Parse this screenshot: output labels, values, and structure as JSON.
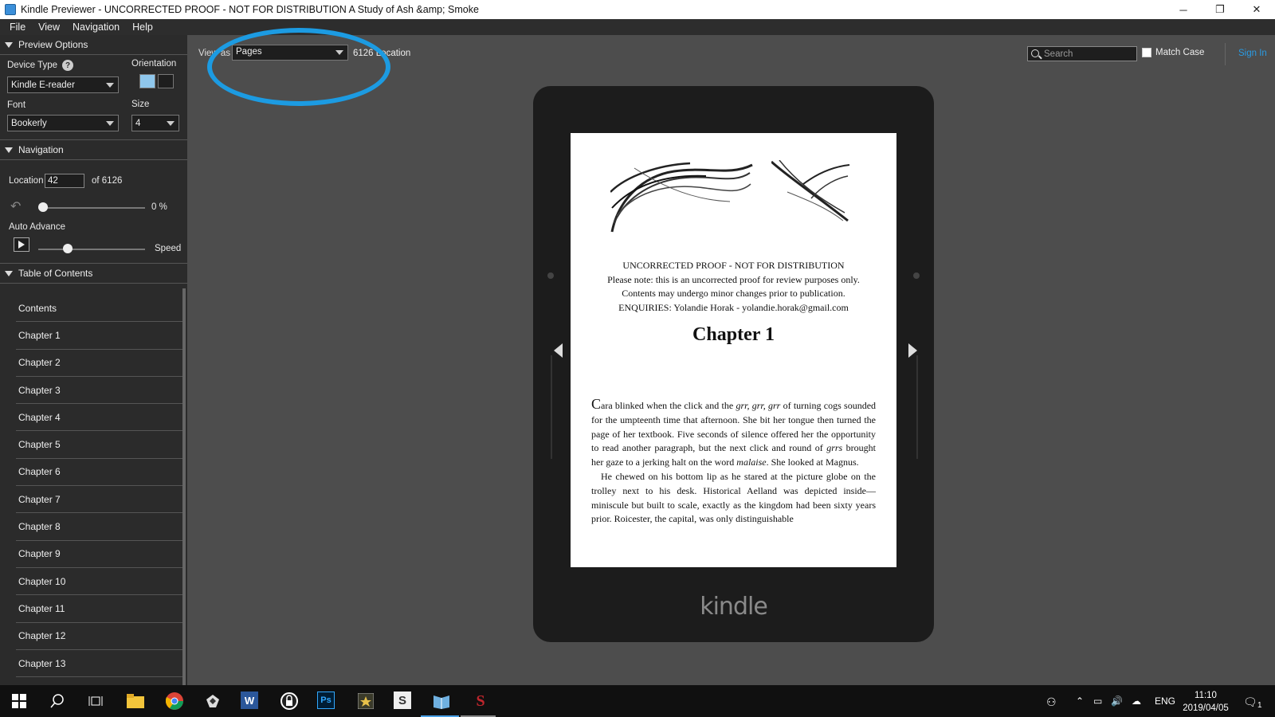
{
  "window": {
    "title": "Kindle Previewer - UNCORRECTED PROOF - NOT FOR DISTRIBUTION A Study of Ash &amp; Smoke",
    "minimize": "─",
    "restore": "❐",
    "close": "✕"
  },
  "menu": [
    "File",
    "View",
    "Navigation",
    "Help"
  ],
  "sidebar": {
    "preview_options": "Preview Options",
    "device_type_label": "Device Type",
    "device_type_value": "Kindle E-reader",
    "orientation_label": "Orientation",
    "font_label": "Font",
    "font_value": "Bookerly",
    "size_label": "Size",
    "size_value": "4",
    "navigation": "Navigation",
    "location_label": "Location",
    "location_value": "42",
    "location_of": "of 6126",
    "progress_percent": "0 %",
    "progress_fraction": 0,
    "auto_advance": "Auto Advance",
    "speed_label": "Speed",
    "speed_fraction": 0.25,
    "toc_header": "Table of Contents",
    "toc": [
      "Contents",
      "Chapter 1",
      "Chapter 2",
      "Chapter 3",
      "Chapter 4",
      "Chapter 5",
      "Chapter 6",
      "Chapter 7",
      "Chapter 8",
      "Chapter 9",
      "Chapter 10",
      "Chapter 11",
      "Chapter 12",
      "Chapter 13"
    ]
  },
  "toolbar": {
    "view_label": "View as",
    "view_value": "Pages",
    "location_count": "6126 Location",
    "search_placeholder": "Search",
    "match_case": "Match Case",
    "sign_in": "Sign In"
  },
  "page": {
    "proof_lines": [
      "UNCORRECTED PROOF - NOT FOR DISTRIBUTION",
      "Please note: this is an uncorrected proof for review purposes only.",
      "Contents may undergo minor changes prior to publication.",
      "ENQUIRIES: Yolandie Horak - yolandie.horak@gmail.com"
    ],
    "chapter_title": "Chapter 1",
    "dropcap": "C",
    "para1_a": "ara blinked when the click and the ",
    "para1_italic": "grr, grr, grr",
    "para1_b": " of turning cogs sounded for the umpteenth time that afternoon. She bit her tongue then turned the page of her textbook. Five seconds of silence offered her the opportunity to read another paragraph, but the next click and round of ",
    "para1_italic2": "grrs",
    "para1_c": " brought her gaze to a jerking halt on the word ",
    "para1_italic3": "malaise",
    "para1_d": ". She looked at Magnus.",
    "para2": "He chewed on his bottom lip as he stared at the picture globe on the trolley next to his desk. Historical Aelland was depicted inside—miniscule but built to scale, exactly as the kingdom had been sixty years prior. Roicester, the capital, was only distinguishable",
    "device_logo": "kindle"
  },
  "taskbar": {
    "apps": [
      "start-icon",
      "search-icon",
      "task-view-icon",
      "file-explorer-icon",
      "chrome-icon",
      "app-icon",
      "word-icon",
      "vpn-icon",
      "photoshop-icon",
      "app-icon",
      "scrivener-icon",
      "kindle-previewer-icon",
      "app-icon"
    ],
    "word_glyph": "W",
    "ps_glyph": "Ps",
    "s_glyph": "S",
    "s2_glyph": "S",
    "lang": "ENG",
    "time": "11:10",
    "date": "2019/04/05",
    "notif_count": "1"
  },
  "colors": {
    "accent": "#1c9be2",
    "sidebar_bg": "#2b2b2b",
    "viewer_bg": "#4d4d4d"
  }
}
